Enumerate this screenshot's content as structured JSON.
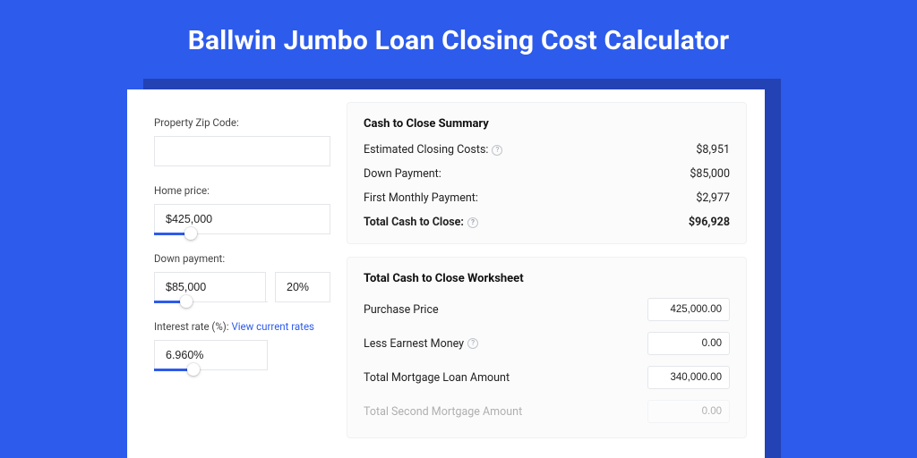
{
  "title": "Ballwin Jumbo Loan Closing Cost Calculator",
  "form": {
    "zip_label": "Property Zip Code:",
    "zip_value": "",
    "home_price_label": "Home price:",
    "home_price_value": "$425,000",
    "home_price_slider_pct": 21,
    "down_payment_label": "Down payment:",
    "down_payment_value": "$85,000",
    "down_payment_pct_value": "20%",
    "down_payment_slider_pct": 28,
    "interest_label": "Interest rate (%):",
    "interest_link": "View current rates",
    "interest_value": "6.960%",
    "interest_slider_pct": 35
  },
  "summary": {
    "heading": "Cash to Close Summary",
    "rows": [
      {
        "label": "Estimated Closing Costs:",
        "value": "$8,951",
        "hint": true
      },
      {
        "label": "Down Payment:",
        "value": "$85,000",
        "hint": false
      },
      {
        "label": "First Monthly Payment:",
        "value": "$2,977",
        "hint": false
      }
    ],
    "total_label": "Total Cash to Close:",
    "total_value": "$96,928"
  },
  "worksheet": {
    "heading": "Total Cash to Close Worksheet",
    "rows": [
      {
        "label": "Purchase Price",
        "value": "425,000.00",
        "hint": false
      },
      {
        "label": "Less Earnest Money",
        "value": "0.00",
        "hint": true
      },
      {
        "label": "Total Mortgage Loan Amount",
        "value": "340,000.00",
        "hint": false
      },
      {
        "label": "Total Second Mortgage Amount",
        "value": "0.00",
        "hint": false
      }
    ]
  }
}
